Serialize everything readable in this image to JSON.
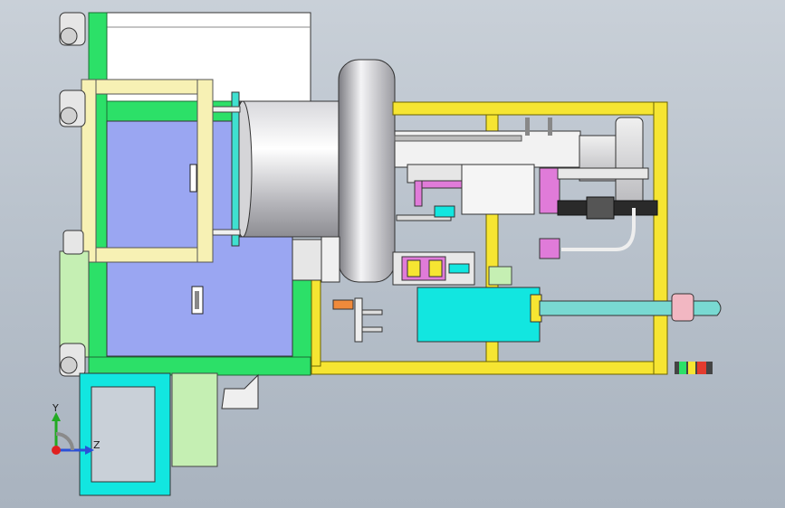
{
  "axis_triad": {
    "y_label": "Y",
    "z_label": "Z"
  },
  "colors": {
    "frame_green": "#2ce068",
    "frame_cream": "#f7f1b4",
    "frame_yellow": "#f6e532",
    "panel_blue": "#9aa6f2",
    "cyan_block": "#12e6e0",
    "cyan_tube": "#79d9d2",
    "light_green": "#c5efb3",
    "pink": "#e07bd9",
    "orange": "#f08a3b",
    "background_top": "#c9d0d8",
    "background_bottom": "#a9b3bf"
  }
}
